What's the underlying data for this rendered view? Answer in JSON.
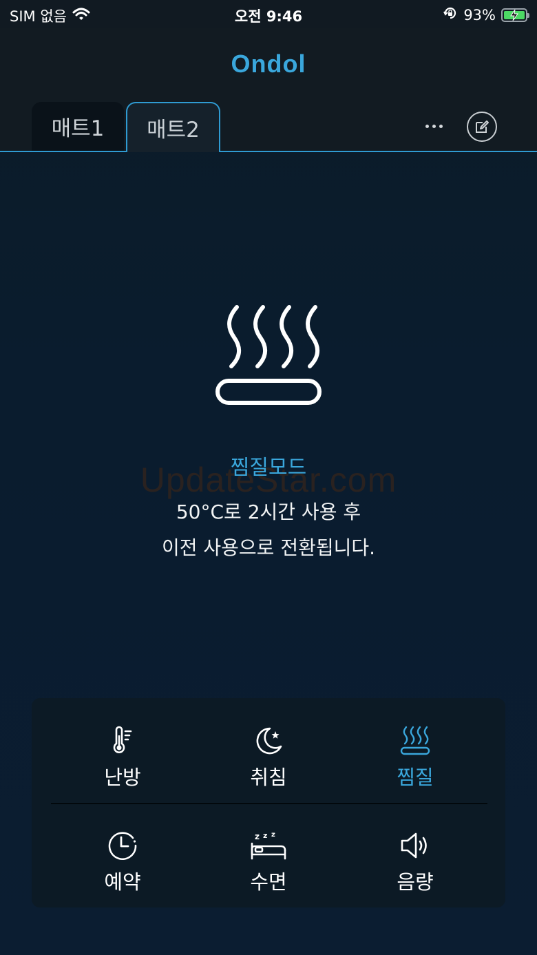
{
  "status_bar": {
    "carrier": "SIM 없음",
    "time": "오전 9:46",
    "battery": "93%"
  },
  "app": {
    "logo": "Ondol"
  },
  "tabs": [
    {
      "label": "매트1",
      "selected": false
    },
    {
      "label": "매트2",
      "selected": true
    }
  ],
  "mode": {
    "title": "찜질모드",
    "line1": "50°C로 2시간 사용 후",
    "line2": "이전 사용으로 전환됩니다."
  },
  "watermark": "UpdateStar.com",
  "colors": {
    "accent": "#3aa7dc",
    "background": "#0a1c2e",
    "panel": "#0c1a25"
  },
  "controls": [
    {
      "label": "난방",
      "icon": "thermometer-icon",
      "active": false
    },
    {
      "label": "취침",
      "icon": "moon-star-icon",
      "active": false
    },
    {
      "label": "찜질",
      "icon": "steam-icon",
      "active": true
    },
    {
      "label": "예약",
      "icon": "clock-icon",
      "active": false
    },
    {
      "label": "수면",
      "icon": "sleep-bed-icon",
      "active": false
    },
    {
      "label": "음량",
      "icon": "speaker-icon",
      "active": false
    }
  ]
}
